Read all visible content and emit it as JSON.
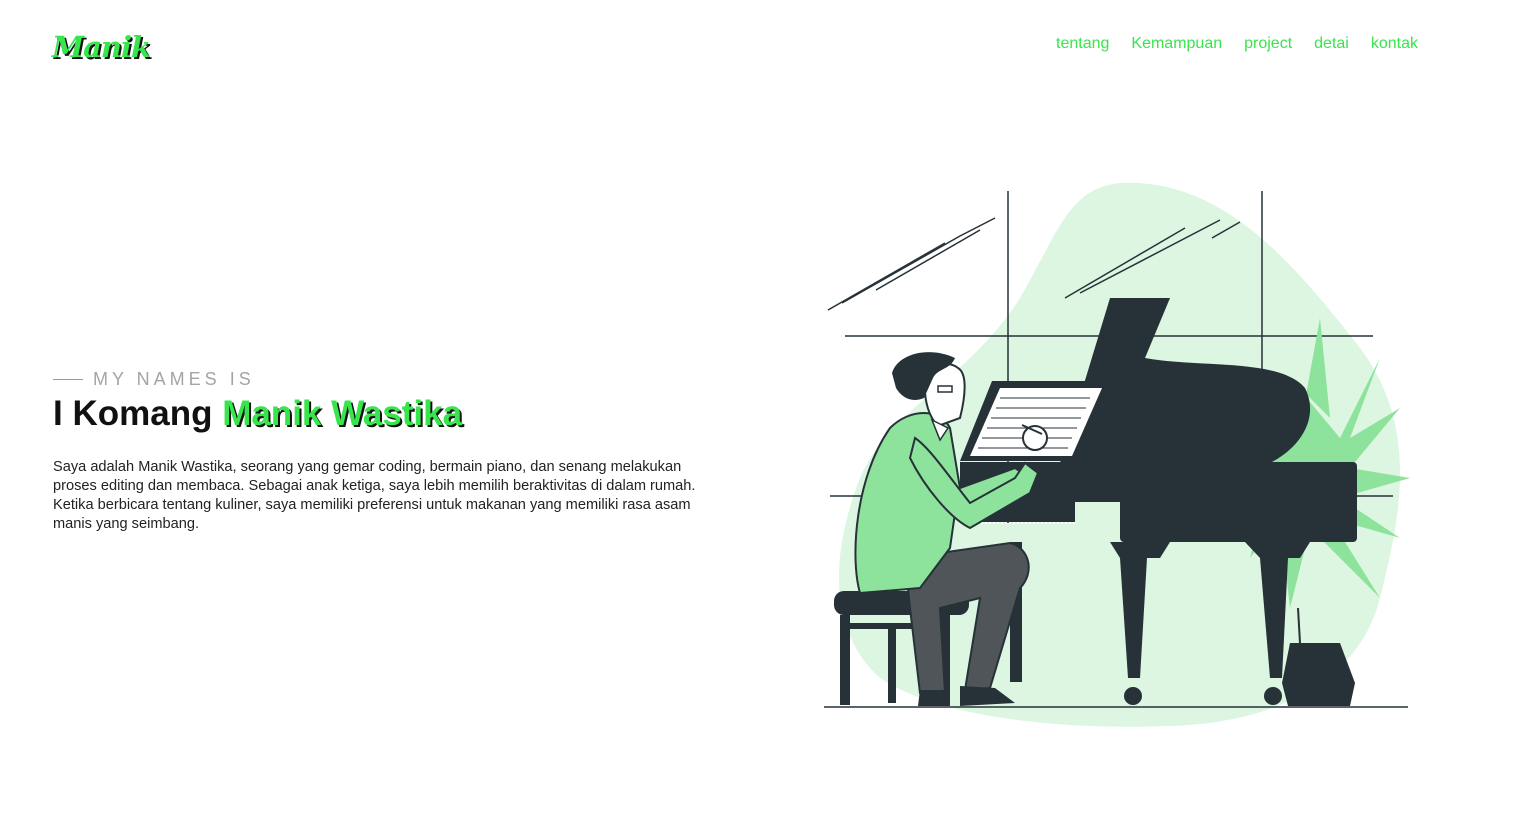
{
  "header": {
    "logo": "Manik",
    "nav": [
      {
        "label": "tentang"
      },
      {
        "label": "Kemampuan"
      },
      {
        "label": "project"
      },
      {
        "label": "detai"
      },
      {
        "label": "kontak"
      }
    ]
  },
  "hero": {
    "eyebrow": "MY NAMES IS",
    "title_prefix": "I Komang ",
    "title_accent": "Manik Wastika",
    "bio": "Saya adalah Manik Wastika, seorang yang gemar coding, bermain piano, dan senang melakukan proses editing dan membaca. Sebagai anak ketiga, saya lebih memilih beraktivitas di dalam rumah. Ketika berbicara tentang kuliner, saya memiliki preferensi untuk makanan yang memiliki rasa asam manis yang seimbang."
  },
  "illustration": {
    "name": "man-playing-piano-illustration"
  },
  "colors": {
    "accent": "#38e54d",
    "blob": "#dcf6e2",
    "shirt": "#8ee39c",
    "dark": "#263238"
  }
}
